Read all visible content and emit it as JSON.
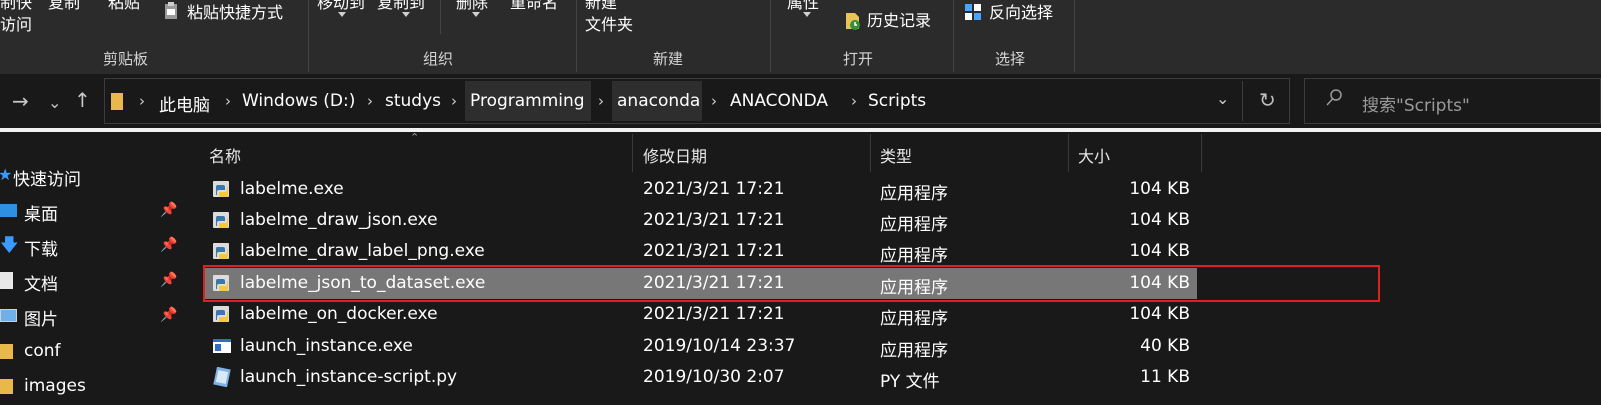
{
  "ribbon": {
    "clipboard": {
      "copy_path_line1": "制快",
      "copy_path_line2": "访问",
      "copy_label": "复制",
      "paste_label": "粘贴",
      "paste_shortcut_label": "粘贴快捷方式",
      "group_label": "剪贴板"
    },
    "organize": {
      "move_to_label": "移动到",
      "copy_to_label": "复制到",
      "delete_label": "删除",
      "rename_label": "重命名",
      "group_label": "组织"
    },
    "new": {
      "new_folder_line1": "新建",
      "new_folder_line2": "文件夹",
      "group_label": "新建"
    },
    "open": {
      "properties_label": "属性",
      "history_label": "历史记录",
      "group_label": "打开"
    },
    "select": {
      "invert_label": "反向选择",
      "group_label": "选择"
    }
  },
  "address": {
    "crumbs": [
      "此电脑",
      "Windows (D:)",
      "studys",
      "Programming",
      "anaconda",
      "ANACONDA",
      "Scripts"
    ]
  },
  "search": {
    "placeholder": "搜索\"Scripts\""
  },
  "sidebar": {
    "items": [
      {
        "label": "快速访问",
        "icon": "star-icon",
        "pinned": false
      },
      {
        "label": "桌面",
        "icon": "desktop-icon",
        "pinned": true
      },
      {
        "label": "下载",
        "icon": "download-icon",
        "pinned": true
      },
      {
        "label": "文档",
        "icon": "document-icon",
        "pinned": true
      },
      {
        "label": "图片",
        "icon": "picture-icon",
        "pinned": true
      },
      {
        "label": "conf",
        "icon": "folder-icon",
        "pinned": false
      },
      {
        "label": "images",
        "icon": "folder-icon",
        "pinned": false
      }
    ]
  },
  "columns": {
    "name": "名称",
    "date": "修改日期",
    "type": "类型",
    "size": "大小"
  },
  "files": [
    {
      "name": "labelme.exe",
      "date": "2021/3/21 17:21",
      "type": "应用程序",
      "size": "104 KB",
      "icon": "python-exe-icon",
      "selected": false
    },
    {
      "name": "labelme_draw_json.exe",
      "date": "2021/3/21 17:21",
      "type": "应用程序",
      "size": "104 KB",
      "icon": "python-exe-icon",
      "selected": false
    },
    {
      "name": "labelme_draw_label_png.exe",
      "date": "2021/3/21 17:21",
      "type": "应用程序",
      "size": "104 KB",
      "icon": "python-exe-icon",
      "selected": false
    },
    {
      "name": "labelme_json_to_dataset.exe",
      "date": "2021/3/21 17:21",
      "type": "应用程序",
      "size": "104 KB",
      "icon": "python-exe-icon",
      "selected": true
    },
    {
      "name": "labelme_on_docker.exe",
      "date": "2021/3/21 17:21",
      "type": "应用程序",
      "size": "104 KB",
      "icon": "python-exe-icon",
      "selected": false
    },
    {
      "name": "launch_instance.exe",
      "date": "2019/10/14 23:37",
      "type": "应用程序",
      "size": "40 KB",
      "icon": "app-window-icon",
      "selected": false
    },
    {
      "name": "launch_instance-script.py",
      "date": "2019/10/30 2:07",
      "type": "PY 文件",
      "size": "11 KB",
      "icon": "python-script-icon",
      "selected": false
    }
  ],
  "colors": {
    "background": "#191919",
    "ribbon": "#2b2b2b",
    "selected_row": "#777777",
    "highlight_border": "#e02020"
  }
}
